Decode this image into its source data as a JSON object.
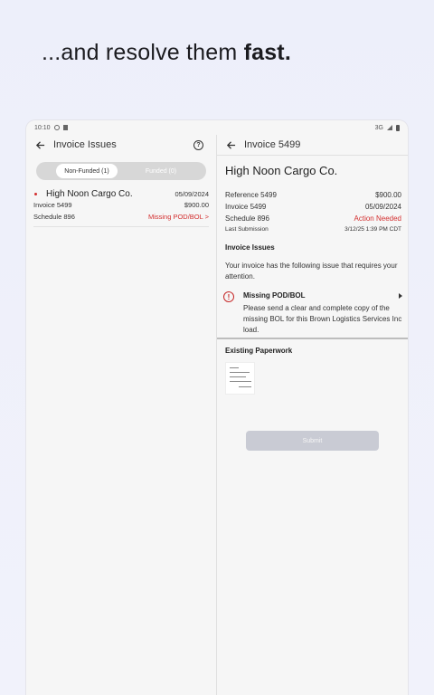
{
  "headline": {
    "normal": "...and resolve them ",
    "bold": "fast."
  },
  "status_bar": {
    "time": "10:10",
    "network": "3G"
  },
  "left_pane": {
    "title": "Invoice Issues",
    "tabs": [
      {
        "label": "Non-Funded (1)",
        "active": true
      },
      {
        "label": "Funded (0)",
        "active": false
      }
    ],
    "invoices": [
      {
        "company": "High Noon Cargo Co.",
        "date": "05/09/2024",
        "invoice": "Invoice 5499",
        "amount": "$900.00",
        "schedule": "Schedule 896",
        "issue": "Missing POD/BOL >"
      }
    ]
  },
  "right_pane": {
    "title": "Invoice 5499",
    "company": "High Noon Cargo Co.",
    "details": [
      {
        "label": "Reference 5499",
        "value": "$900.00"
      },
      {
        "label": "Invoice 5499",
        "value": "05/09/2024"
      },
      {
        "label": "Schedule 896",
        "value": "Action Needed"
      },
      {
        "label": "Last Submission",
        "value": "3/12/25 1:39 PM CDT"
      }
    ],
    "issues_heading": "Invoice Issues",
    "issues_intro": "Your invoice has the following issue that requires your attention.",
    "issue": {
      "title": "Missing POD/BOL",
      "text": "Please send a clear and complete copy of the missing BOL for this Brown Logistics Services Inc load."
    },
    "paperwork_heading": "Existing Paperwork",
    "submit_label": "Submit"
  },
  "colors": {
    "alert_red": "#d32f2f",
    "submit_disabled": "#c9cbd4",
    "background": "#edeffa"
  }
}
